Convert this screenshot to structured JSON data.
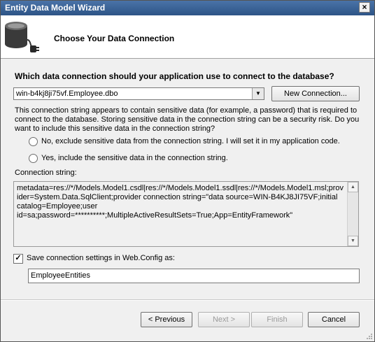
{
  "window": {
    "title": "Entity Data Model Wizard",
    "close_label": "×"
  },
  "header": {
    "title": "Choose Your Data Connection",
    "icon": "database-connection-icon"
  },
  "question": "Which data connection should your application use to connect to the database?",
  "connection": {
    "selected": "win-b4kj8ji75vf.Employee.dbo",
    "new_button": "New Connection..."
  },
  "sensitive_info": "This connection string appears to contain sensitive data (for example, a password) that is required to connect to the database. Storing sensitive data in the connection string can be a security risk. Do you want to include this sensitive data in the connection string?",
  "options": {
    "exclude": {
      "label": "No, exclude sensitive data from the connection string. I will set it in my application code.",
      "selected": false
    },
    "include": {
      "label": "Yes, include the sensitive data in the connection string.",
      "selected": false
    }
  },
  "connection_string": {
    "label": "Connection string:",
    "value": "metadata=res://*/Models.Model1.csdl|res://*/Models.Model1.ssdl|res://*/Models.Model1.msl;provider=System.Data.SqlClient;provider connection string=\"data source=WIN-B4KJ8JI75VF;initial catalog=Employee;user id=sa;password=**********;MultipleActiveResultSets=True;App=EntityFramework\""
  },
  "save_settings": {
    "label": "Save connection settings in Web.Config as:",
    "checked": true,
    "value": "EmployeeEntities"
  },
  "buttons": {
    "previous": "< Previous",
    "next": "Next >",
    "finish": "Finish",
    "cancel": "Cancel"
  }
}
